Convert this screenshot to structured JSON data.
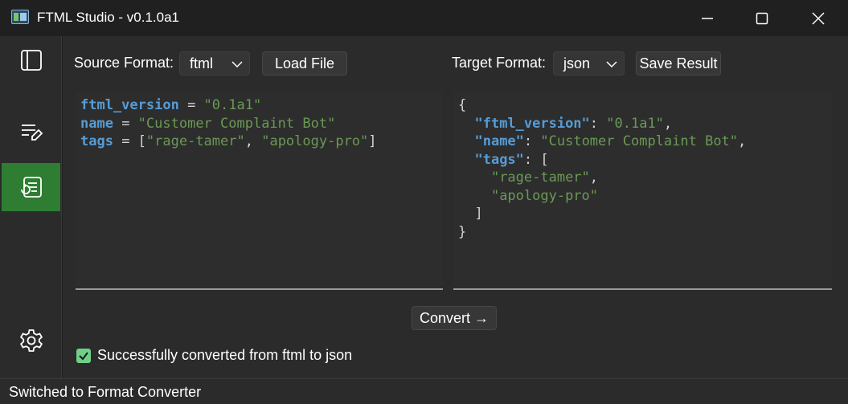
{
  "window": {
    "title": "FTML Studio - v0.1.0a1",
    "controls": [
      "minimize-icon",
      "maximize-icon",
      "close-icon"
    ]
  },
  "sidebar": {
    "items": [
      {
        "icon": "sidebar-panel-icon",
        "active": false
      },
      {
        "icon": "edit-list-icon",
        "active": false
      },
      {
        "icon": "convert-document-icon",
        "active": true
      },
      {
        "icon": "gear-icon",
        "active": false
      }
    ],
    "active_color": "#2e7d32"
  },
  "toolbar": {
    "source_label": "Source Format:",
    "source_value": "ftml",
    "load_label": "Load File",
    "target_label": "Target Format:",
    "target_value": "json",
    "save_label": "Save Result"
  },
  "source_editor": {
    "lines": [
      {
        "key": "ftml_version",
        "op": " = ",
        "value": "\"0.1a1\""
      },
      {
        "key": "name",
        "op": " = ",
        "value": "\"Customer Complaint Bot\""
      },
      {
        "key": "tags",
        "op": " = [",
        "v1": "\"rage-tamer\"",
        "sep": ", ",
        "v2": "\"apology-pro\"",
        "end": "]"
      }
    ]
  },
  "target_editor": {
    "open_brace": "{",
    "k1": "\"ftml_version\"",
    "v1": "\"0.1a1\"",
    "k2": "\"name\"",
    "v2": "\"Customer Complaint Bot\"",
    "k3": "\"tags\"",
    "arr_open": "[",
    "t1": "\"rage-tamer\"",
    "t2": "\"apology-pro\"",
    "arr_close": "]",
    "close_brace": "}"
  },
  "convert_label": "Convert →",
  "status": {
    "checked": true,
    "message": "Successfully converted from ftml to json"
  },
  "statusbar": {
    "text": "Switched to Format Converter"
  },
  "colors": {
    "key": "#569cd6",
    "string": "#6a9955",
    "check": "#6fd08a"
  }
}
